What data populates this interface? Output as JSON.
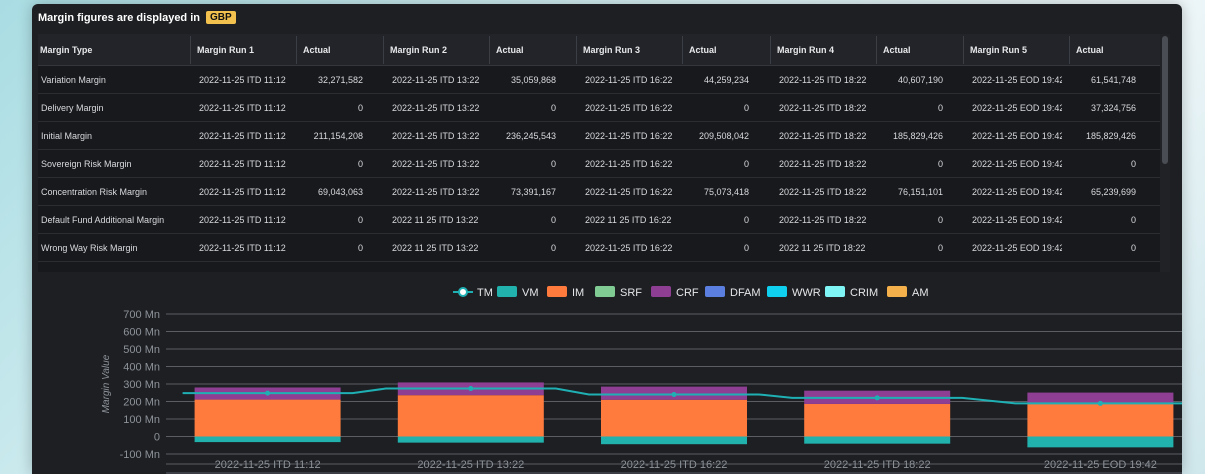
{
  "notice": {
    "text": "Margin figures are displayed in",
    "currency": "GBP"
  },
  "grid": {
    "columns": [
      "Margin Type",
      "Margin Run 1",
      "Actual",
      "Margin Run 2",
      "Actual",
      "Margin Run 3",
      "Actual",
      "Margin Run 4",
      "Actual",
      "Margin Run 5",
      "Actual"
    ],
    "rows": [
      [
        "Variation Margin",
        "2022-11-25 ITD 11:12",
        "32,271,582",
        "2022-11-25 ITD 13:22",
        "35,059,868",
        "2022-11-25 ITD 16:22",
        "44,259,234",
        "2022-11-25 ITD 18:22",
        "40,607,190",
        "2022-11-25 EOD 19:42",
        "61,541,748"
      ],
      [
        "Delivery Margin",
        "2022-11-25 ITD 11:12",
        "0",
        "2022-11-25 ITD 13:22",
        "0",
        "2022-11-25 ITD 16:22",
        "0",
        "2022-11-25 ITD 18:22",
        "0",
        "2022-11-25 EOD 19:42",
        "37,324,756"
      ],
      [
        "Initial Margin",
        "2022-11-25 ITD 11:12",
        "211,154,208",
        "2022-11-25 ITD 13:22",
        "236,245,543",
        "2022-11-25 ITD 16:22",
        "209,508,042",
        "2022-11-25 ITD 18:22",
        "185,829,426",
        "2022-11-25 EOD 19:42",
        "185,829,426"
      ],
      [
        "Sovereign Risk Margin",
        "2022-11-25 ITD 11:12",
        "0",
        "2022-11-25 ITD 13:22",
        "0",
        "2022-11-25 ITD 16:22",
        "0",
        "2022-11-25 ITD 18:22",
        "0",
        "2022-11-25 EOD 19:42",
        "0"
      ],
      [
        "Concentration Risk Margin",
        "2022-11-25 ITD 11:12",
        "69,043,063",
        "2022-11-25 ITD 13:22",
        "73,391,167",
        "2022-11-25 ITD 16:22",
        "75,073,418",
        "2022-11-25 ITD 18:22",
        "76,151,101",
        "2022-11-25 EOD 19:42",
        "65,239,699"
      ],
      [
        "Default Fund Additional Margin",
        "2022-11-25 ITD 11:12",
        "0",
        "2022 11 25 ITD 13:22",
        "0",
        "2022 11 25 ITD 16:22",
        "0",
        "2022-11-25 ITD 18:22",
        "0",
        "2022-11-25 EOD 19:42",
        "0"
      ],
      [
        "Wrong Way Risk Margin",
        "2022-11-25 ITD 11:12",
        "0",
        "2022 11 25 ITD 13:22",
        "0",
        "2022-11-25 ITD 16:22",
        "0",
        "2022 11 25 ITD 18:22",
        "0",
        "2022-11-25 EOD 19:42",
        "0"
      ]
    ]
  },
  "colors": {
    "TM": "#1fb0b4",
    "VM": "#22b2ad",
    "IM": "#ff7a3d",
    "SRF": "#7fcb93",
    "CRF": "#8e3f93",
    "DFAM": "#5b7fe0",
    "WWR": "#10d0f0",
    "CRIM": "#7ff4f4",
    "AM": "#f4b04a"
  },
  "chart_data": {
    "type": "bar",
    "legend": [
      "TM",
      "VM",
      "IM",
      "SRF",
      "CRF",
      "DFAM",
      "WWR",
      "CRIM",
      "AM"
    ],
    "legend_placement": "top-center",
    "categories": [
      "2022-11-25 ITD 11:12",
      "2022-11-25 ITD 13:22",
      "2022-11-25 ITD 16:22",
      "2022-11-25 ITD 18:22",
      "2022-11-25 EOD 19:42"
    ],
    "ylabel": "Margin Value",
    "yticks": [
      "700 Mn",
      "600 Mn",
      "500 Mn",
      "400 Mn",
      "300 Mn",
      "200 Mn",
      "100 Mn",
      "0",
      "-100 Mn"
    ],
    "ylim": [
      -100,
      700
    ],
    "series": [
      {
        "name": "VM",
        "values": [
          -32,
          -35,
          -44,
          -41,
          -62
        ]
      },
      {
        "name": "IM",
        "values": [
          211,
          236,
          210,
          186,
          186
        ]
      },
      {
        "name": "CRF",
        "values": [
          69,
          73,
          75,
          76,
          65
        ]
      },
      {
        "name": "TM",
        "values": [
          248,
          274,
          240,
          221,
          189
        ]
      }
    ]
  }
}
